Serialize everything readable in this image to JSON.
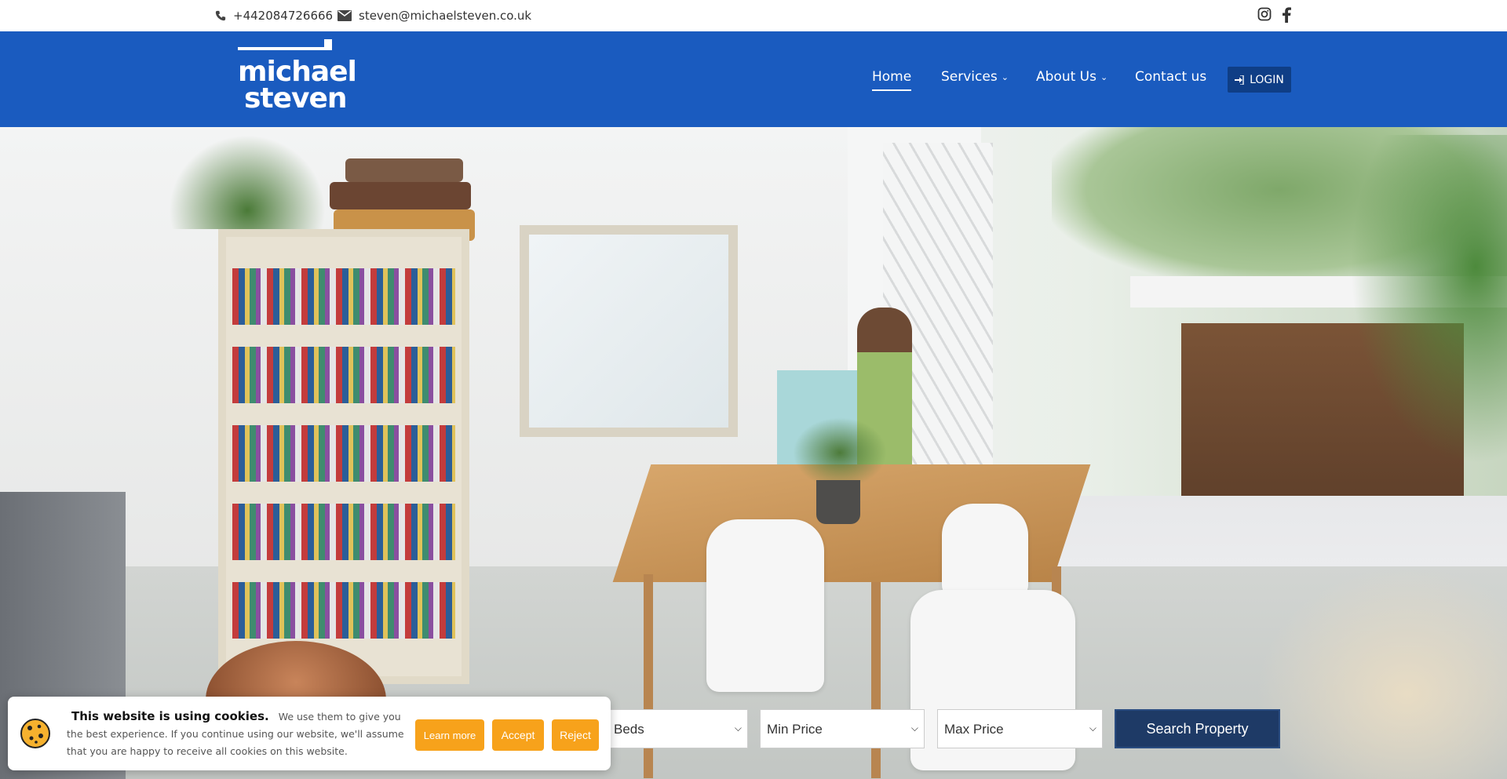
{
  "topbar": {
    "phone": "+442084726666",
    "email": "steven@michaelsteven.co.uk",
    "icons": [
      "phone-icon",
      "envelope-icon",
      "instagram-icon",
      "facebook-icon"
    ]
  },
  "header": {
    "logo_line1": "michael",
    "logo_line2": "steven",
    "nav": [
      {
        "label": "Home",
        "active": true
      },
      {
        "label": "Services",
        "dropdown": true
      },
      {
        "label": "About Us",
        "dropdown": true
      },
      {
        "label": "Contact us"
      }
    ],
    "login_label": "LOGIN",
    "colors": {
      "header_bg": "#1a5bbf",
      "login_bg": "#0f3e86"
    }
  },
  "search": {
    "beds_selected": "Beds",
    "min_price_selected": "Min Price",
    "max_price_selected": "Max Price",
    "button_label": "Search Property",
    "colors": {
      "button_bg": "#1e3a66"
    }
  },
  "cookie_banner": {
    "title": "This website is using cookies.",
    "body": "We use them to give you the best experience. If you continue using our website, we'll assume that you are happy to receive all cookies on this website.",
    "learn_more": "Learn more",
    "accept": "Accept",
    "reject": "Reject",
    "colors": {
      "button_bg": "#f7a21b"
    }
  }
}
